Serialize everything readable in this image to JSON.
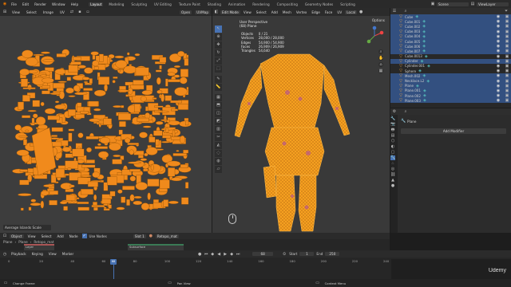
{
  "menubar": {
    "menus": [
      "File",
      "Edit",
      "Render",
      "Window",
      "Help"
    ],
    "tabs": [
      "Layout",
      "Modeling",
      "Sculpting",
      "UV Editing",
      "Texture Paint",
      "Shading",
      "Animation",
      "Rendering",
      "Compositing",
      "Geometry Nodes",
      "Scripting"
    ],
    "active_tab": "Layout",
    "scene": "Scene",
    "view_layer": "ViewLayer"
  },
  "uv_editor": {
    "header_menus": [
      "View",
      "Select",
      "Image",
      "UV"
    ],
    "image_name": "UVMap",
    "sync_label": "Open",
    "bottom_label": "Average Islands Scale"
  },
  "viewport": {
    "mode": "Edit Mode",
    "menus": [
      "View",
      "Select",
      "Add",
      "Mesh",
      "Vertex",
      "Edge",
      "Face",
      "UV"
    ],
    "orientation": "Local",
    "options_label": "Options",
    "view_name": "User Perspective",
    "object_name": "(68) Plane",
    "stats": [
      {
        "label": "Objects",
        "value": "0 / 21"
      },
      {
        "label": "Vertices",
        "value": "28,000 / 28,000"
      },
      {
        "label": "Edges",
        "value": "54,900 / 54,900"
      },
      {
        "label": "Faces",
        "value": "26,909 / 26,909"
      },
      {
        "label": "Triangles",
        "value": "54,640"
      }
    ]
  },
  "outliner": {
    "items": [
      {
        "name": "Cube",
        "sel": true
      },
      {
        "name": "Cube.001",
        "sel": true
      },
      {
        "name": "Cube.002",
        "sel": true
      },
      {
        "name": "Cube.003",
        "sel": true
      },
      {
        "name": "Cube.004",
        "sel": true
      },
      {
        "name": "Cube.005",
        "sel": true
      },
      {
        "name": "Cube.006",
        "sel": true
      },
      {
        "name": "Cube.007",
        "sel": true
      },
      {
        "name": "Cube.0013",
        "sel": false
      },
      {
        "name": "Cylinder",
        "sel": true
      },
      {
        "name": "Cylinder.001",
        "sel": false
      },
      {
        "name": "Sphere",
        "sel": false
      },
      {
        "name": "Mesh.002",
        "sel": true
      },
      {
        "name": "Necklace.L2",
        "sel": true
      },
      {
        "name": "Plane",
        "sel": true
      },
      {
        "name": "Plane.001",
        "sel": true
      },
      {
        "name": "Plane.002",
        "sel": true
      },
      {
        "name": "Plane.003",
        "sel": true
      }
    ]
  },
  "properties": {
    "object": "Plane",
    "add_modifier": "Add Modifier"
  },
  "shader_editor": {
    "header": [
      "Object",
      "View",
      "Select",
      "Add",
      "Node"
    ],
    "use_nodes": "Use Nodes",
    "slot": "Slot 1",
    "material": "Retopo_mat",
    "breadcrumb": [
      "Plane",
      "Plane",
      "Retopo_mat"
    ],
    "left_items": [
      "Plane",
      "Layer"
    ],
    "right_items": [
      "Subsurface",
      "Specular",
      "Emission"
    ]
  },
  "timeline": {
    "menus": [
      "Playback",
      "Keying",
      "View",
      "Marker"
    ],
    "frame_numbers": [
      "0",
      "20",
      "40",
      "60",
      "80",
      "100",
      "120",
      "140",
      "160",
      "180",
      "200",
      "220",
      "240"
    ],
    "current_frame": "68",
    "start_label": "Start",
    "start": "1",
    "end_label": "End",
    "end": "250"
  },
  "statusbar": {
    "left": "Change Frame",
    "middle": "Pan View",
    "right": "Context Menu"
  },
  "watermark": "Udemy",
  "colors": {
    "accent": "#4772b3",
    "uv_orange": "#f08a1c",
    "mesh_orange": "#f5a020"
  }
}
